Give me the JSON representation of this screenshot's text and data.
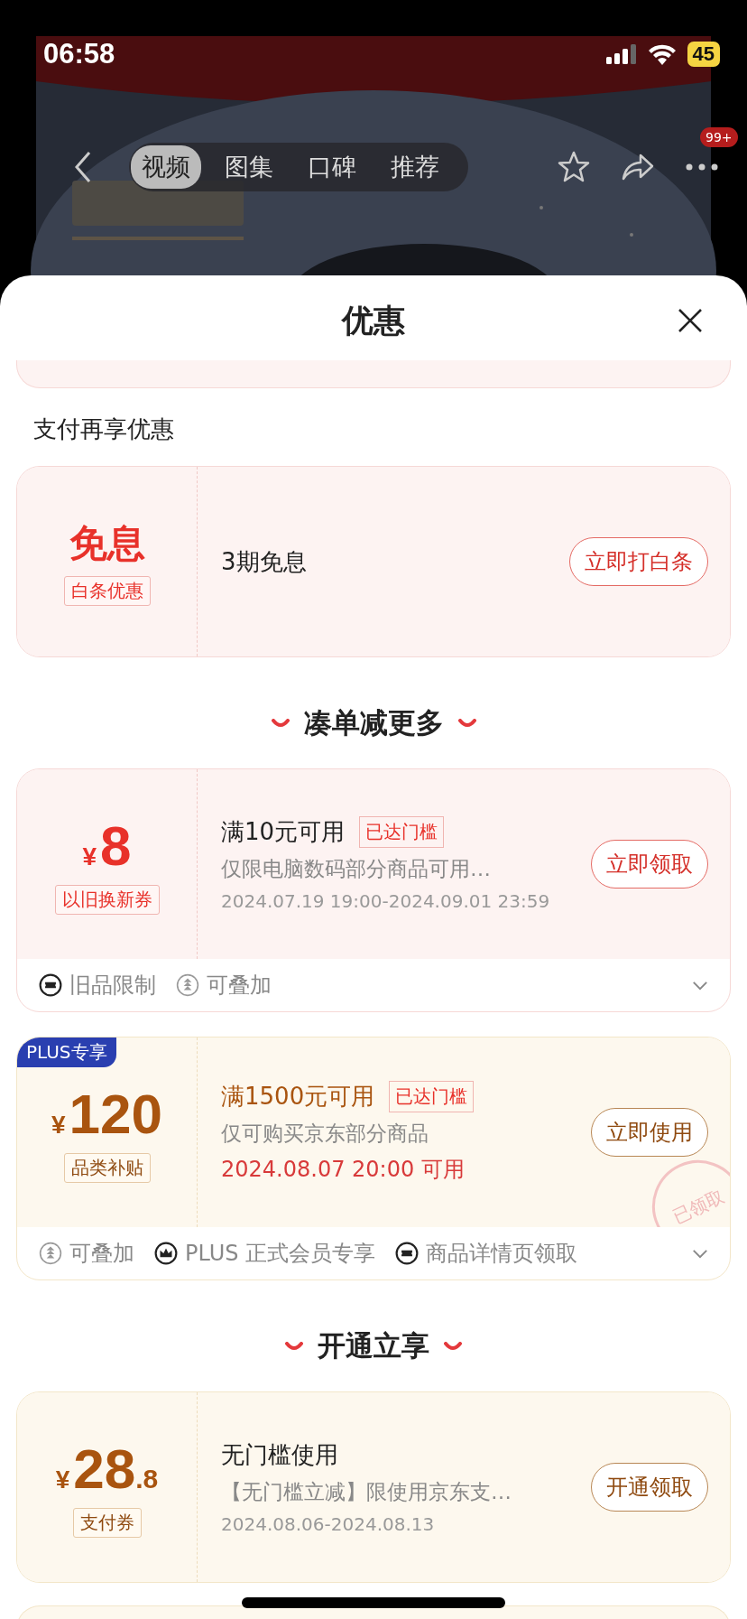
{
  "status_bar": {
    "time": "06:58",
    "battery": "45"
  },
  "nav": {
    "tabs": [
      {
        "label": "视频",
        "selected": true
      },
      {
        "label": "图集",
        "selected": false
      },
      {
        "label": "口碑",
        "selected": false
      },
      {
        "label": "推荐",
        "selected": false
      }
    ],
    "badge": "99+"
  },
  "sheet": {
    "title": "优惠",
    "sections": [
      {
        "heading": "支付再享优惠",
        "kind": "plain",
        "coupons": [
          {
            "kind": "red",
            "amount": {
              "value": "免息"
            },
            "tag": "白条优惠",
            "title": "3期免息",
            "button": "立即打白条"
          }
        ]
      },
      {
        "heading": "凑单减更多",
        "kind": "decorated",
        "coupons": [
          {
            "kind": "red",
            "amount": {
              "currency": "¥",
              "value": "8"
            },
            "tag": "以旧换新券",
            "title": "满10元可用",
            "threshold": "已达门槛",
            "desc": "仅限电脑数码部分商品可用…",
            "date": "2024.07.19 19:00-2024.09.01 23:59",
            "date_highlight": false,
            "button": "立即领取",
            "features": [
              {
                "kind": "ticket",
                "label": "旧品限制"
              },
              {
                "kind": "stack",
                "label": "可叠加"
              }
            ]
          },
          {
            "kind": "gold",
            "plus_badge": "PLUS专享",
            "amount": {
              "currency": "¥",
              "value": "120"
            },
            "tag": "品类补贴",
            "title": "满1500元可用",
            "title_highlight": true,
            "threshold": "已达门槛",
            "desc": "仅可购买京东部分商品",
            "date": "2024.08.07 20:00 可用",
            "date_highlight": true,
            "button": "立即使用",
            "stamp": "已领取",
            "features": [
              {
                "kind": "stack",
                "label": "可叠加"
              },
              {
                "kind": "crown",
                "label": "PLUS 正式会员专享"
              },
              {
                "kind": "ticket",
                "label": "商品详情页领取"
              }
            ]
          }
        ]
      },
      {
        "heading": "开通立享",
        "kind": "decorated",
        "coupons": [
          {
            "kind": "gold",
            "amount": {
              "currency": "¥",
              "value": "28",
              "decimal": ".8"
            },
            "tag": "支付券",
            "title": "无门槛使用",
            "title_highlight": false,
            "desc": "【无门槛立减】限使用京东支…",
            "date": "2024.08.06-2024.08.13",
            "date_highlight": false,
            "button": "开通领取"
          }
        ]
      }
    ]
  }
}
